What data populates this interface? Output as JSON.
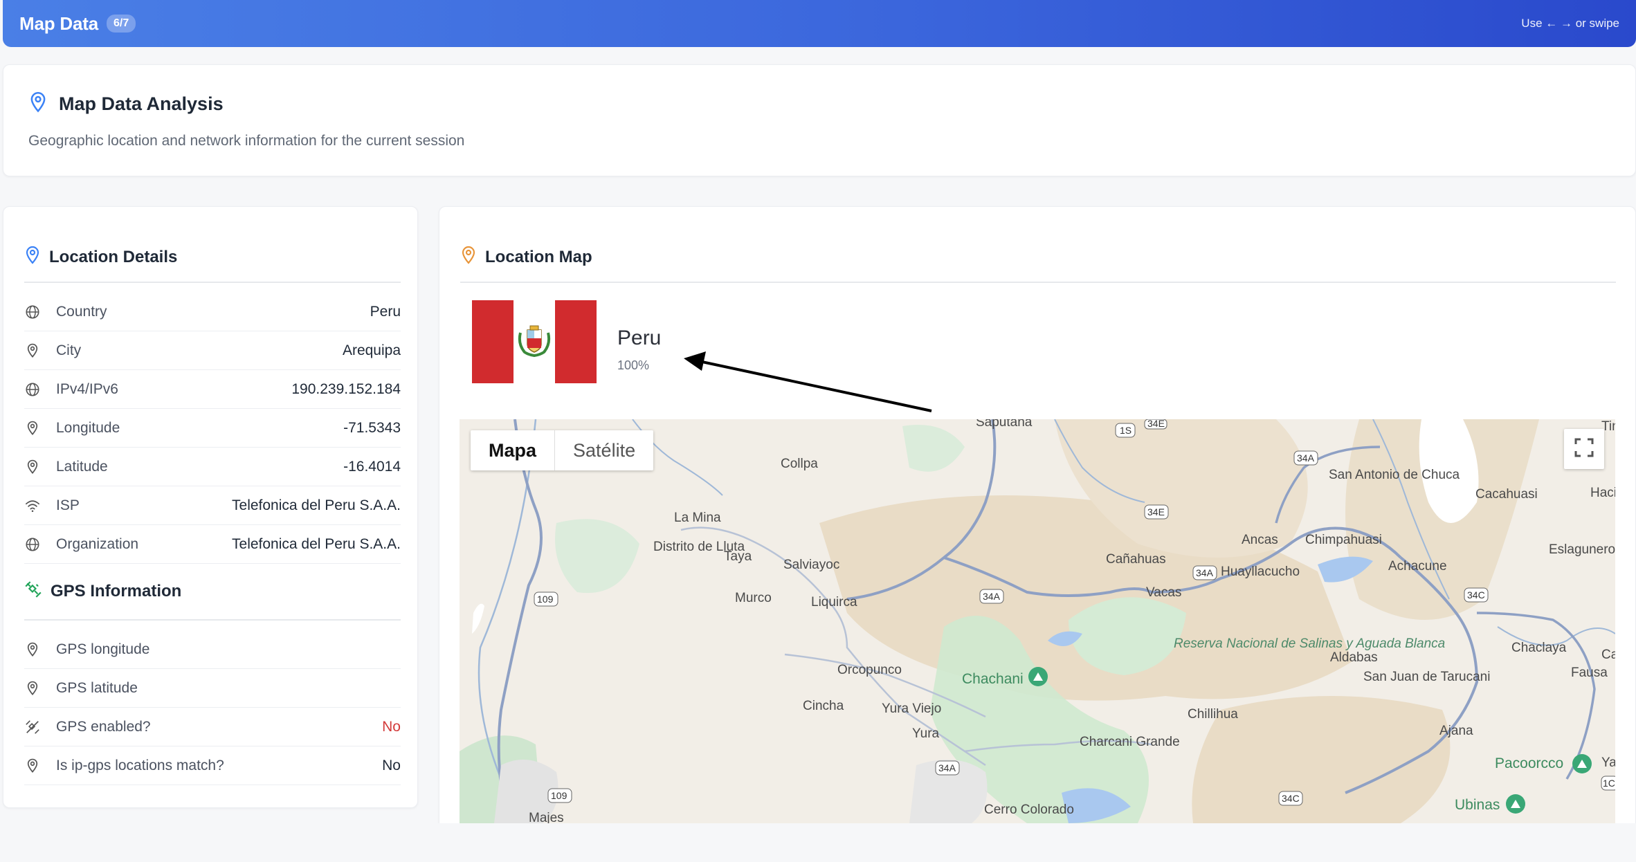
{
  "header": {
    "title": "Map Data",
    "badge": "6/7",
    "hint": "Use ← → or swipe"
  },
  "summary": {
    "title": "Map Data Analysis",
    "description": "Geographic location and network information for the current session"
  },
  "location_details": {
    "title": "Location Details",
    "rows": [
      {
        "label": "Country",
        "value": "Peru",
        "icon": "globe-icon"
      },
      {
        "label": "City",
        "value": "Arequipa",
        "icon": "pin-icon"
      },
      {
        "label": "IPv4/IPv6",
        "value": "190.239.152.184",
        "icon": "globe-icon"
      },
      {
        "label": "Longitude",
        "value": "-71.5343",
        "icon": "pin-icon"
      },
      {
        "label": "Latitude",
        "value": "-16.4014",
        "icon": "pin-icon"
      },
      {
        "label": "ISP",
        "value": "Telefonica del Peru S.A.A.",
        "icon": "wifi-icon"
      },
      {
        "label": "Organization",
        "value": "Telefonica del Peru S.A.A.",
        "icon": "globe-icon"
      }
    ]
  },
  "gps_info": {
    "title": "GPS Information",
    "rows": [
      {
        "label": "GPS longitude",
        "value": "",
        "icon": "pin-icon"
      },
      {
        "label": "GPS latitude",
        "value": "",
        "icon": "pin-icon"
      },
      {
        "label": "GPS enabled?",
        "value": "No",
        "icon": "satellite-off-icon"
      },
      {
        "label": "Is ip-gps locations match?",
        "value": "No",
        "icon": "pin-icon"
      }
    ]
  },
  "location_map": {
    "title": "Location Map",
    "country": "Peru",
    "confidence": "100%",
    "toggle": {
      "map": "Mapa",
      "satellite": "Satélite"
    },
    "places": [
      "Saputana",
      "Collpa",
      "La Mina",
      "Distrito de Lluta",
      "Taya",
      "Salviayoc",
      "Murco",
      "Liquirca",
      "Orcopunco",
      "Cincha",
      "Yura Viejo",
      "Yura",
      "Chachani",
      "Cañahuas",
      "Vacas",
      "Ancas",
      "Chimpahuasi",
      "Huayllacucho",
      "Achacune",
      "San Antonio de Chuca",
      "Cacahuasi",
      "Hacie Toro",
      "Eslagunero",
      "Reserva Nacional de Salinas y Aguada Blanca",
      "Chillihua",
      "Charcani Grande",
      "Aldabas",
      "San Juan de Tarucani",
      "Chaclaya",
      "Fausa",
      "Casa",
      "Ajana",
      "Pacoorcco",
      "Ubinas",
      "Cerro Colorado",
      "Majes",
      "Tin",
      "Ya"
    ],
    "roads": [
      "1S",
      "34E",
      "34A",
      "109",
      "34C",
      "1C",
      "34C"
    ]
  },
  "colors": {
    "accent": "#3b66dc",
    "flag_red": "#d12b2e",
    "alert": "#d33a3a",
    "pin_orange": "#e8953a"
  }
}
